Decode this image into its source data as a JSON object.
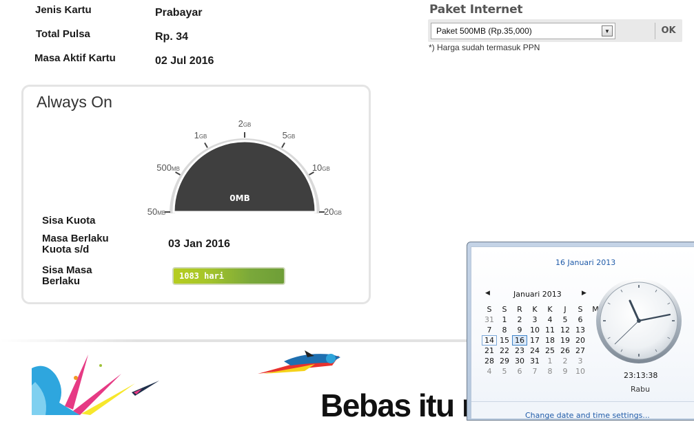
{
  "card_info": {
    "jenis_label": "Jenis Kartu",
    "jenis_value": "Prabayar",
    "pulsa_label": "Total Pulsa",
    "pulsa_value": "Rp. 34",
    "masa_label": "Masa Aktif Kartu",
    "masa_value": "02 Jul 2016"
  },
  "paket": {
    "title": "Paket Internet",
    "selected": "Paket 500MB (Rp.35,000)",
    "ok_label": "OK",
    "note": "*) Harga sudah termasuk PPN"
  },
  "always_on": {
    "title": "Always On",
    "gauge": {
      "center_label": "0MB",
      "ticks": [
        {
          "num": "50",
          "unit": "MB"
        },
        {
          "num": "500",
          "unit": "MB"
        },
        {
          "num": "1",
          "unit": "GB"
        },
        {
          "num": "2",
          "unit": "GB"
        },
        {
          "num": "5",
          "unit": "GB"
        },
        {
          "num": "10",
          "unit": "GB"
        },
        {
          "num": "20",
          "unit": "GB"
        }
      ],
      "fill_color": "#3f3f3f"
    },
    "sisa_kuota_label": "Sisa Kuota",
    "masa_berlaku_label_1": "Masa Berlaku",
    "masa_berlaku_label_2": "Kuota s/d",
    "masa_berlaku_value": "03 Jan 2016",
    "sisa_masa_label_1": "Sisa Masa",
    "sisa_masa_label_2": "Berlaku",
    "sisa_masa_value": "1083  hari"
  },
  "banner": {
    "headline": "Bebas itu m"
  },
  "flyout": {
    "date_link": "16 Januari 2013",
    "month_label": "Januari 2013",
    "prev_icon": "triangle-left-icon",
    "next_icon": "triangle-right-icon",
    "weekdays": [
      "S",
      "S",
      "R",
      "K",
      "K",
      "J",
      "S",
      "M"
    ],
    "weeks": [
      [
        "31",
        "1",
        "2",
        "3",
        "4",
        "5",
        "6"
      ],
      [
        "7",
        "8",
        "9",
        "10",
        "11",
        "12",
        "13"
      ],
      [
        "14",
        "15",
        "16",
        "17",
        "18",
        "19",
        "20"
      ],
      [
        "21",
        "22",
        "23",
        "24",
        "25",
        "26",
        "27"
      ],
      [
        "28",
        "29",
        "30",
        "31",
        "1",
        "2",
        "3"
      ],
      [
        "4",
        "5",
        "6",
        "7",
        "8",
        "9",
        "10"
      ]
    ],
    "today": "16",
    "time": "23:13:38",
    "day": "Rabu",
    "footer_link": "Change date and time settings..."
  }
}
